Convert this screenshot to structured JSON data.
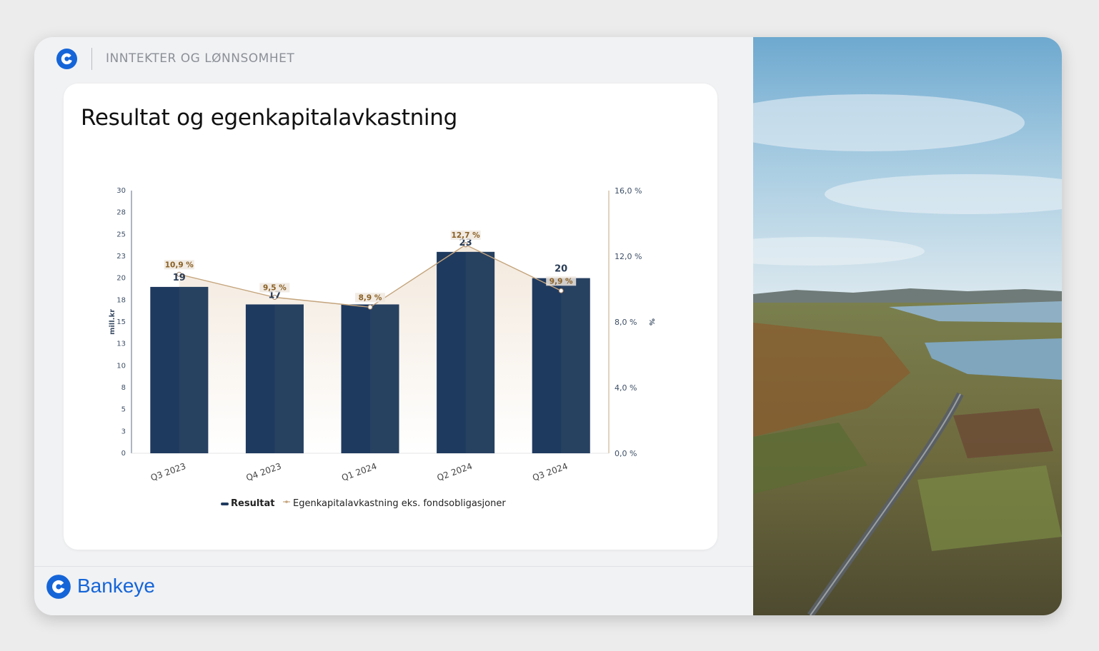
{
  "header": {
    "section_title": "INNTEKTER OG LØNNSOMHET"
  },
  "card": {
    "title": "Resultat og egenkapitalavkastning"
  },
  "footer": {
    "brand": "Bankeye"
  },
  "colors": {
    "brand_blue": "#1565d8",
    "bar": "#1f3a5f",
    "line": "#c4a47c",
    "area": "#f3e9dd"
  },
  "chart_data": {
    "type": "bar",
    "title": "Resultat og egenkapitalavkastning",
    "categories": [
      "Q3 2023",
      "Q4 2023",
      "Q1 2024",
      "Q2 2024",
      "Q3 2024"
    ],
    "series": [
      {
        "name": "Resultat",
        "type": "bar",
        "axis": "left",
        "values": [
          19,
          17,
          17,
          23,
          20
        ],
        "labels": [
          "19",
          "17",
          "",
          "23",
          "20"
        ]
      },
      {
        "name": "Egenkapitalavkastning eks. fondsobligasjoner",
        "type": "line",
        "axis": "right",
        "values": [
          10.9,
          9.5,
          8.9,
          12.7,
          9.9
        ],
        "labels": [
          "10,9 %",
          "9,5 %",
          "8,9 %",
          "12,7 %",
          "9,9 %"
        ]
      }
    ],
    "ylabel": "mill.kr",
    "y2label": "%",
    "ylim": [
      0,
      30
    ],
    "y2lim": [
      0,
      16
    ],
    "yticks": [
      "0",
      "3",
      "5",
      "8",
      "10",
      "13",
      "15",
      "18",
      "20",
      "23",
      "25",
      "28",
      "30"
    ],
    "y2ticks": [
      "0,0 %",
      "4,0 %",
      "8,0 %",
      "12,0 %",
      "16,0 %"
    ],
    "legend": "bottom"
  }
}
